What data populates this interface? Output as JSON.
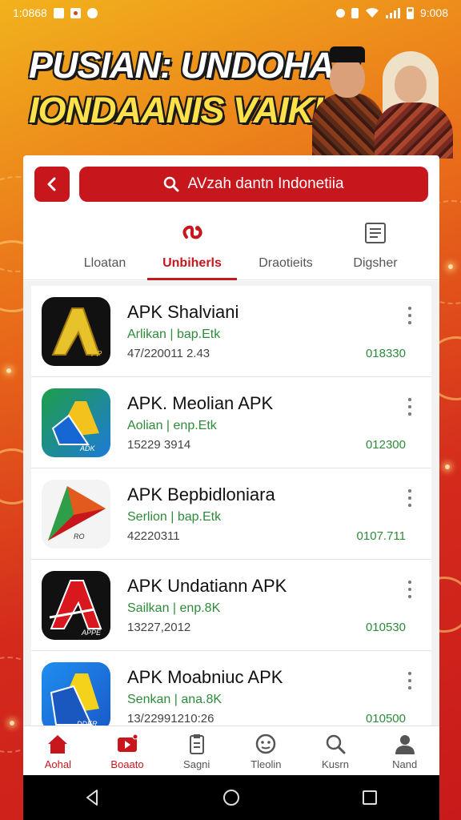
{
  "status_bar": {
    "time_left": "1:0868",
    "time_right": "9:008"
  },
  "banner": {
    "title_line1": "PUSIAN: UNDOHAN",
    "title_line2": "IONDAANIS VAIKIA"
  },
  "search": {
    "text": "AVzah dantn Indonetiia"
  },
  "tabs": [
    {
      "label": "Lloatan",
      "icon": "none",
      "active": false
    },
    {
      "label": "Unbiherls",
      "icon": "share-loop-icon",
      "active": true
    },
    {
      "label": "Draotieits",
      "icon": "none",
      "active": false
    },
    {
      "label": "Digsher",
      "icon": "document-icon",
      "active": false
    }
  ],
  "apps": [
    {
      "name": "APK Shalviani",
      "sub": "Arlikan | bap.Etk",
      "date": "47/220011 2.43",
      "size": "018330",
      "icon": "gold-a-icon"
    },
    {
      "name": "APK. Meolian APK",
      "sub": "Aolian | enp.Etk",
      "date": "15229 3914",
      "size": "012300",
      "icon": "blue-drive-icon"
    },
    {
      "name": "APK Bepbidloniara",
      "sub": "Serlion | bap.Etk",
      "date": "42220311",
      "size": "0107.711",
      "icon": "play-triangle-icon"
    },
    {
      "name": "APK Undatiann APK",
      "sub": "Sailkan | enp.8K",
      "date": "13227,2012",
      "size": "010530",
      "icon": "red-a-icon"
    },
    {
      "name": "APK Moabniuc APK",
      "sub": "Senkan | ana.8K",
      "date": "13/22991210:26",
      "size": "010500",
      "icon": "blue-yellow-icon"
    }
  ],
  "bottom_nav": [
    {
      "label": "Aohal",
      "icon": "home-icon",
      "active": true
    },
    {
      "label": "Boaato",
      "icon": "video-icon",
      "active": true
    },
    {
      "label": "Sagni",
      "icon": "clipboard-icon",
      "active": false
    },
    {
      "label": "Tleolin",
      "icon": "face-icon",
      "active": false
    },
    {
      "label": "Kusrn",
      "icon": "search-icon",
      "active": false
    },
    {
      "label": "Nand",
      "icon": "user-icon",
      "active": false
    }
  ],
  "colors": {
    "accent": "#c8161d",
    "green_text": "#2e8b3a"
  }
}
